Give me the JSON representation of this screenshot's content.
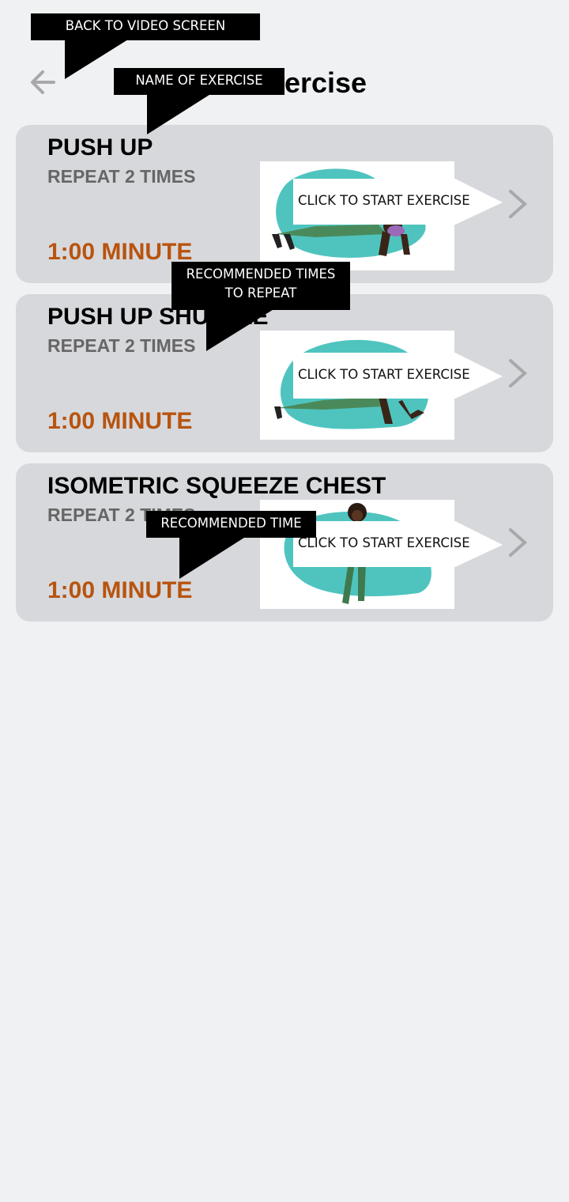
{
  "header": {
    "title": "Exercise"
  },
  "exercises": [
    {
      "name": "PUSH UP",
      "repeat": "REPEAT 2 TIMES",
      "duration": "1:00 MINUTE",
      "cta": "CLICK TO START EXERCISE"
    },
    {
      "name": "PUSH UP SHUFFLE",
      "repeat": "REPEAT 2 TIMES",
      "duration": "1:00 MINUTE",
      "cta": "CLICK TO START EXERCISE"
    },
    {
      "name": "ISOMETRIC SQUEEZE CHEST",
      "repeat": "REPEAT 2 TIMES",
      "duration": "1:00 MINUTE",
      "cta": "CLICK TO START EXERCISE"
    }
  ],
  "annotations": {
    "back": "BACK TO VIDEO SCREEN",
    "name": "NAME OF EXERCISE",
    "repeat_line1": "RECOMMENDED TIMES",
    "repeat_line2": "TO REPEAT",
    "time": "RECOMMENDED TIME"
  },
  "colors": {
    "background": "#f0f1f3",
    "card": "#d7d8dc",
    "duration": "#b8540f",
    "repeat": "#666666",
    "illustration_teal": "#4fc4bf",
    "figure_green": "#4a8a5a",
    "skin": "#3a2418"
  },
  "icons": {
    "back": "arrow-left-icon",
    "chevron": "chevron-right-icon"
  }
}
